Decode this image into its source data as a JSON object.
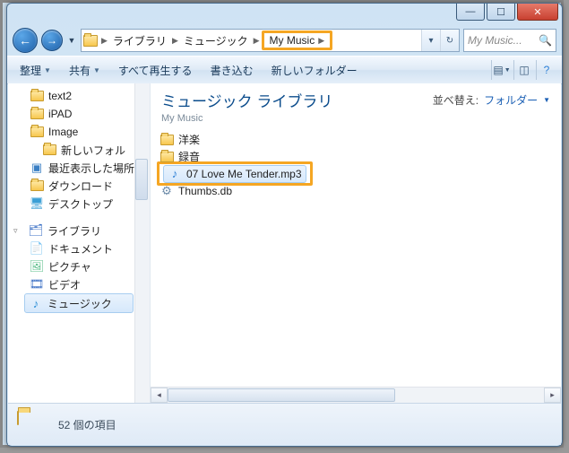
{
  "window_controls": {
    "min": "—",
    "max": "☐",
    "close": "✕"
  },
  "nav": {
    "back": "←",
    "forward": "→"
  },
  "breadcrumbs": {
    "items": [
      "ライブラリ",
      "ミュージック",
      "My Music"
    ],
    "highlighted_index": 2
  },
  "search": {
    "placeholder": "My Music..."
  },
  "toolbar": {
    "organize": "整理",
    "share": "共有",
    "play_all": "すべて再生する",
    "burn": "書き込む",
    "new_folder": "新しいフォルダー"
  },
  "sidebar": {
    "recent_folders": [
      {
        "name": "text2",
        "type": "folder"
      },
      {
        "name": "iPAD",
        "type": "folder"
      },
      {
        "name": "Image",
        "type": "folder"
      },
      {
        "name": "新しいフォル",
        "type": "folder"
      },
      {
        "name": "最近表示した場所",
        "type": "recent"
      },
      {
        "name": "ダウンロード",
        "type": "download"
      },
      {
        "name": "デスクトップ",
        "type": "desktop"
      }
    ],
    "libraries_label": "ライブラリ",
    "libraries": [
      {
        "name": "ドキュメント",
        "kind": "doc"
      },
      {
        "name": "ピクチャ",
        "kind": "pic"
      },
      {
        "name": "ビデオ",
        "kind": "vid"
      },
      {
        "name": "ミュージック",
        "kind": "mus",
        "selected": true
      }
    ]
  },
  "main": {
    "title": "ミュージック ライブラリ",
    "subtitle": "My Music",
    "arrange_label": "並べ替え:",
    "arrange_value": "フォルダー",
    "items": [
      {
        "name": "洋楽",
        "type": "folder"
      },
      {
        "name": "録音",
        "type": "folder"
      },
      {
        "name": "07 Love Me Tender.mp3",
        "type": "audio",
        "highlighted": true,
        "selected": true
      },
      {
        "name": "Thumbs.db",
        "type": "db"
      }
    ]
  },
  "status": {
    "text": "52 個の項目"
  }
}
